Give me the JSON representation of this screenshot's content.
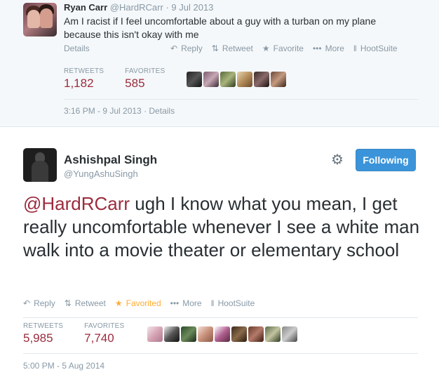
{
  "tweet1": {
    "name": "Ryan Carr",
    "handle": "@HardRCarr",
    "date": "9 Jul 2013",
    "text": "Am I racist if I feel uncomfortable about a guy with a turban on my plane because this isn't okay with me",
    "details_label": "Details",
    "actions": {
      "reply": "Reply",
      "retweet": "Retweet",
      "favorite": "Favorite",
      "more": "More",
      "hootsuite": "HootSuite"
    },
    "stats": {
      "retweets_label": "RETWEETS",
      "retweets_value": "1,182",
      "favorites_label": "FAVORITES",
      "favorites_value": "585"
    },
    "timestamp": "3:16 PM - 9 Jul 2013 · Details"
  },
  "tweet2": {
    "name": "Ashishpal Singh",
    "handle": "@YungAshuSingh",
    "follow_label": "Following",
    "mention": "@HardRCarr",
    "text": " ugh I know what you mean, I get really uncomfortable whenever I see a white man walk into a movie theater or elementary school",
    "actions": {
      "reply": "Reply",
      "retweet": "Retweet",
      "favorited": "Favorited",
      "more": "More",
      "hootsuite": "HootSuite"
    },
    "stats": {
      "retweets_label": "RETWEETS",
      "retweets_value": "5,985",
      "favorites_label": "FAVORITES",
      "favorites_value": "7,740"
    },
    "timestamp": "5:00 PM - 5 Aug 2014"
  },
  "icons": {
    "reply": "reply-arrow-icon",
    "retweet": "retweet-arrows-icon",
    "favorite": "star-icon",
    "more": "ellipsis-icon",
    "hootsuite": "hootsuite-icon",
    "settings": "gear-icon"
  },
  "colors": {
    "accent_red": "#9b2c3d",
    "follow_blue": "#3b94d9",
    "favorited": "#ffac33",
    "muted": "#8899a6"
  }
}
